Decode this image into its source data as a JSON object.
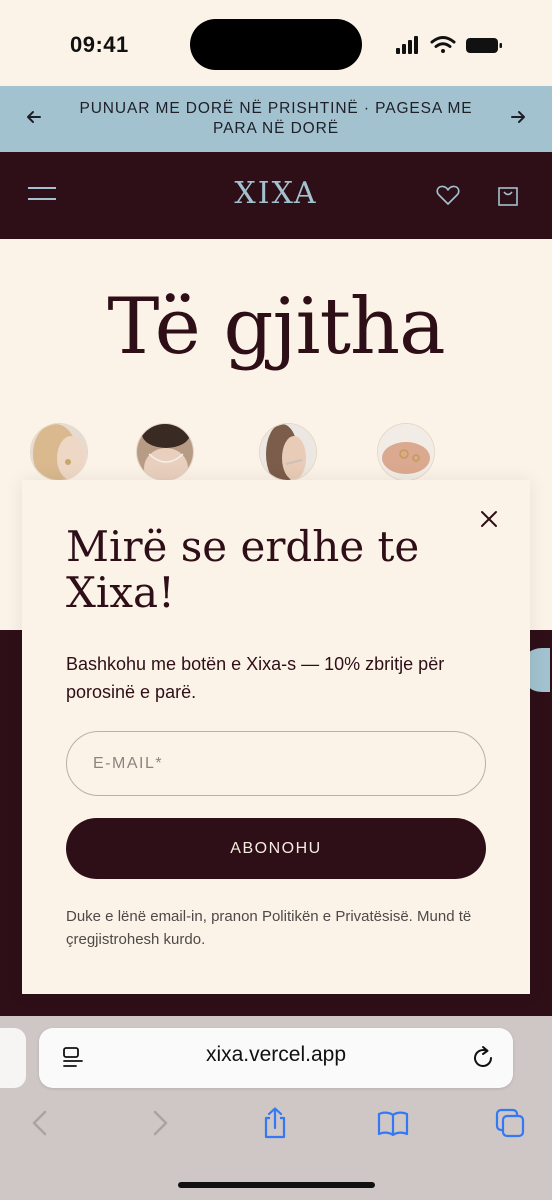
{
  "status_bar": {
    "time": "09:41"
  },
  "announcement": {
    "text": "PUNUAR ME DORË NË PRISHTINË · PAGESA ME PARA NË DORË",
    "prev_icon": "arrow-left-icon",
    "next_icon": "arrow-right-icon"
  },
  "header": {
    "logo": "XIXA",
    "menu_icon": "hamburger-menu-icon",
    "wishlist_icon": "heart-icon",
    "cart_icon": "shopping-bag-icon"
  },
  "page": {
    "title": "Të gjitha"
  },
  "modal": {
    "title": "Mirë se erdhe te Xixa!",
    "subtitle": "Bashkohu me botën e Xixa-s — 10% zbritje për porosinë e parë.",
    "email_placeholder": "E-MAIL*",
    "email_value": "",
    "subscribe_label": "ABONOHU",
    "note": "Duke e lënë email-in, pranon Politikën e Privatësisë. Mund të çregjistrohesh kurdo."
  },
  "browser": {
    "url": "xixa.vercel.app"
  },
  "colors": {
    "brand_dark": "#2e0f18",
    "accent_blue": "#a2c2cf",
    "cream": "#fcf3e8",
    "ios_blue": "#3478f6"
  }
}
